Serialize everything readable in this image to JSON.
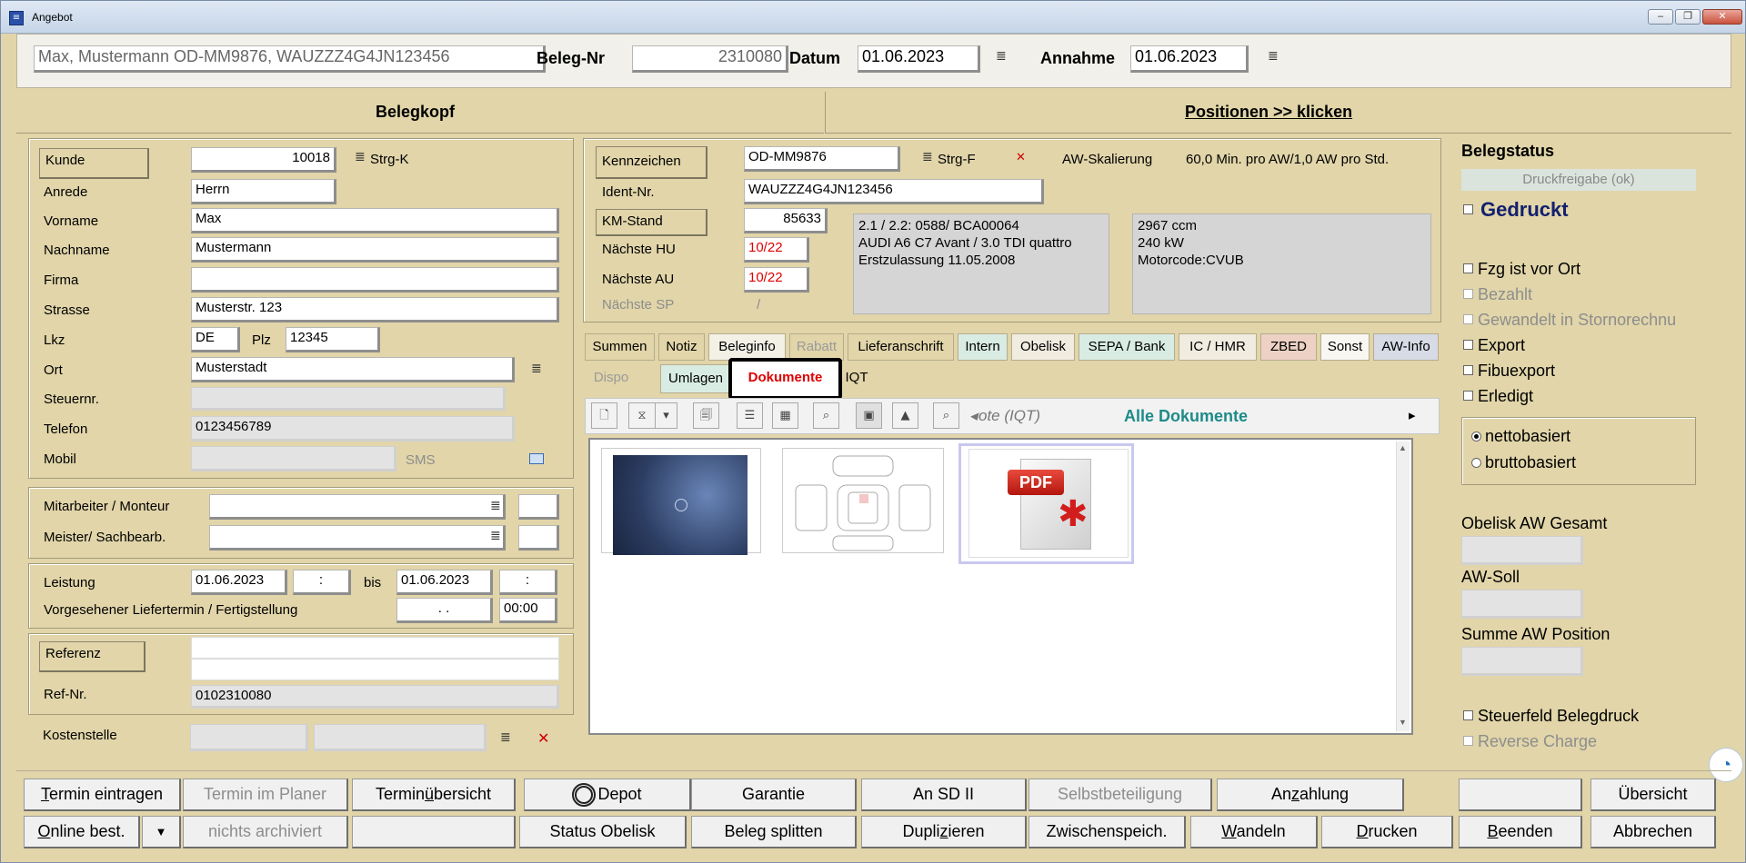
{
  "window": {
    "title": "Angebot",
    "min": "–",
    "max": "❐",
    "close": "✕"
  },
  "header": {
    "vehicle": "Max, Mustermann OD-MM9876, WAUZZZ4G4JN123456",
    "beleg_label": "Beleg-Nr",
    "beleg_value": "2310080",
    "datum_label": "Datum",
    "datum_value": "01.06.2023",
    "annahme_label": "Annahme",
    "annahme_value": "01.06.2023"
  },
  "tabs_top": {
    "belegkopf": "Belegkopf",
    "positionen": "Positionen >> klicken"
  },
  "kunde": {
    "kunde_label": "Kunde",
    "kunde_value": "10018",
    "strg_k": "Strg-K",
    "anrede_label": "Anrede",
    "anrede_value": "Herrn",
    "vorname_label": "Vorname",
    "vorname_value": "Max",
    "nachname_label": "Nachname",
    "nachname_value": "Mustermann",
    "firma_label": "Firma",
    "firma_value": "",
    "strasse_label": "Strasse",
    "strasse_value": "Musterstr. 123",
    "lkz_label": "Lkz",
    "lkz_value": "DE",
    "plz_label": "Plz",
    "plz_value": "12345",
    "ort_label": "Ort",
    "ort_value": "Musterstadt",
    "steuer_label": "Steuernr.",
    "steuer_value": "",
    "telefon_label": "Telefon",
    "telefon_value": "0123456789",
    "mobil_label": "Mobil",
    "mobil_value": "",
    "sms": "SMS"
  },
  "staff": {
    "mitarbeiter_label": "Mitarbeiter / Monteur",
    "meister_label": "Meister/ Sachbearb."
  },
  "leistung": {
    "label": "Leistung",
    "from_date": "01.06.2023",
    "from_time": ":",
    "bis": "bis",
    "to_date": "01.06.2023",
    "to_time": ":",
    "liefer_label": "Vorgesehener Liefertermin / Fertigstellung",
    "liefer_date": ". .",
    "liefer_time": "00:00"
  },
  "referenz": {
    "label": "Referenz",
    "refnr_label": "Ref-Nr.",
    "refnr_value": "0102310080",
    "kosten_label": "Kostenstelle"
  },
  "fahrzeug": {
    "kz_label": "Kennzeichen",
    "kz_value": "OD-MM9876",
    "strg_f": "Strg-F",
    "aw_label": "AW-Skalierung",
    "aw_value": "60,0 Min. pro AW/1,0 AW pro Std.",
    "ident_label": "Ident-Nr.",
    "ident_value": "WAUZZZ4G4JN123456",
    "km_label": "KM-Stand",
    "km_value": "85633",
    "hu_label": "Nächste HU",
    "hu_value": "10/22",
    "au_label": "Nächste AU",
    "au_value": "10/22",
    "sp_label": "Nächste SP",
    "sp_value": "/",
    "info1": [
      "2.1 / 2.2: 0588/ BCA00064",
      "AUDI A6 C7 Avant / 3.0 TDI quattro",
      "Erstzulassung 11.05.2008"
    ],
    "info2": [
      "2967 ccm",
      "240 kW",
      "Motorcode:CVUB"
    ]
  },
  "tabs_row1": [
    "Summen",
    "Notiz",
    "Beleginfo",
    "Rabatt",
    "Lieferanschrift",
    "Intern",
    "Obelisk",
    "SEPA / Bank",
    "IC / HMR",
    "ZBED",
    "Sonst",
    "AW-Info"
  ],
  "tabs_row2": [
    "Dispo",
    "Umlagen",
    "Dokumente",
    "IQT"
  ],
  "docs": {
    "note": "ote (IQT)",
    "title": "Alle Dokumente",
    "pdf": "PDF"
  },
  "status": {
    "title": "Belegstatus",
    "druck": "Druckfreigabe (ok)",
    "gedruckt": "Gedruckt",
    "fzg": "Fzg ist vor Ort",
    "bezahlt": "Bezahlt",
    "gewandelt": "Gewandelt in Stornorechnu",
    "export": "Export",
    "fibu": "Fibuexport",
    "erledigt": "Erledigt",
    "netto": "nettobasiert",
    "brutto": "bruttobasiert",
    "obelisk_aw": "Obelisk AW Gesamt",
    "aw_soll": "AW-Soll",
    "summe_aw": "Summe AW Position",
    "steuerfeld": "Steuerfeld Belegdruck",
    "reverse": "Reverse Charge"
  },
  "bottom": {
    "termin": "ermin eintragen",
    "termin_u": "T",
    "planer": "Termin im Planer",
    "ueber_a": "Termin",
    "ueber_u": "ü",
    "ueber_b": "bersicht",
    "depot": "Depot",
    "garantie": "Garantie",
    "ansd": "An SD II",
    "selbst": "Selbstbeteiligung",
    "anz_a": "An",
    "anz_u": "z",
    "anz_b": "ahlung",
    "uebersicht": "Übersicht",
    "online_u": "O",
    "online": "nline best.",
    "archiv": "nichts archiviert",
    "status_obelisk": "Status Obelisk",
    "splitten": "Beleg splitten",
    "dupl_a": "Dupli",
    "dupl_u": "z",
    "dupl_b": "ieren",
    "zwischen": "Zwischenspeich.",
    "wandeln_u": "W",
    "wandeln": "andeln",
    "drucken_u": "D",
    "drucken": "rucken",
    "beenden_u": "B",
    "beenden": "eenden",
    "abbrechen": "Abbrechen"
  }
}
